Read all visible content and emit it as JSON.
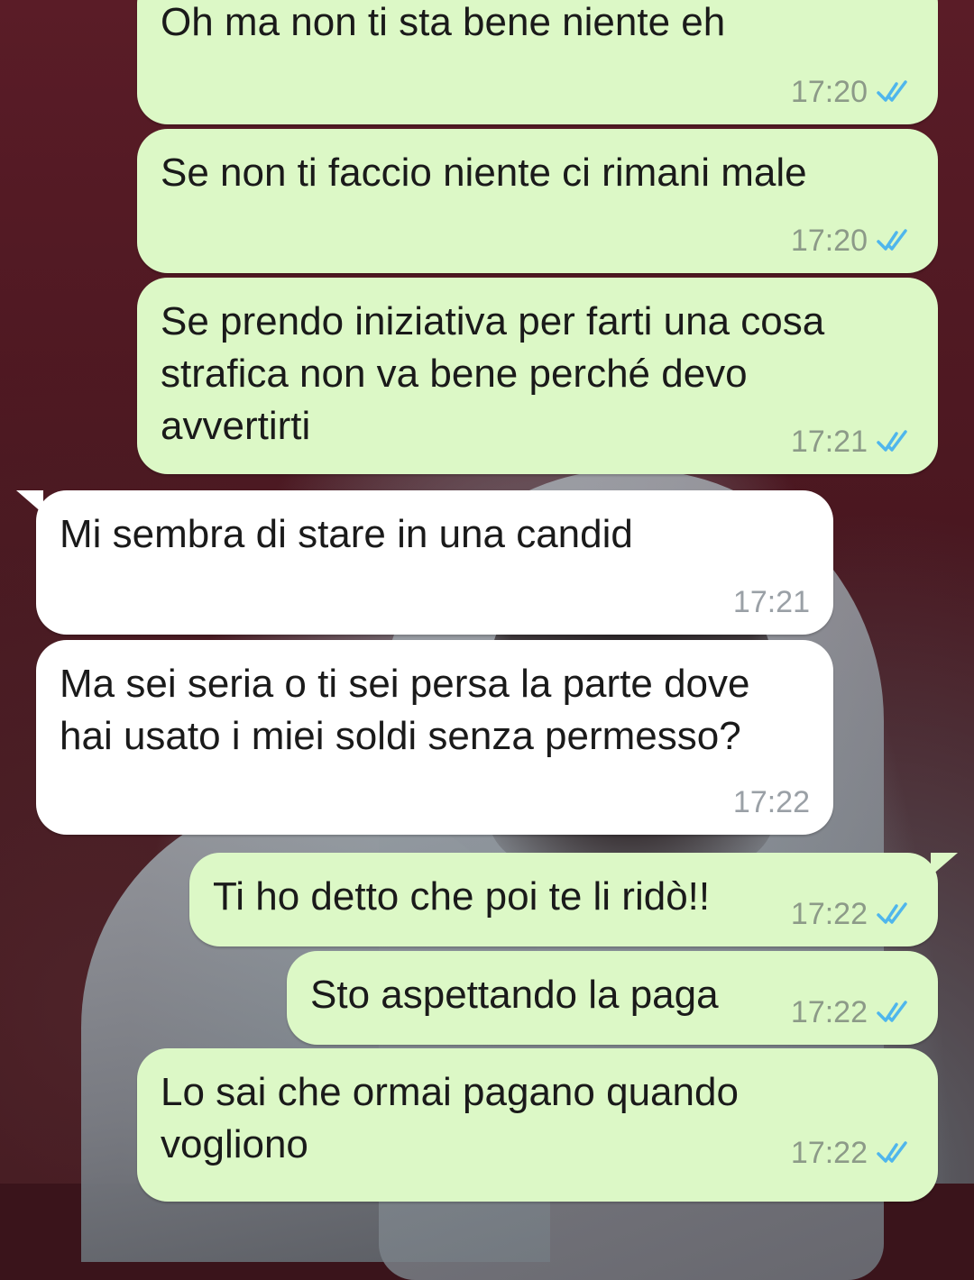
{
  "chat": {
    "messages": [
      {
        "direction": "outgoing",
        "text": "Oh ma non ti sta bene niente eh",
        "time": "17:20",
        "status_icon": "double-check-read-icon"
      },
      {
        "direction": "outgoing",
        "text": "Se non ti faccio niente ci rimani male",
        "time": "17:20",
        "status_icon": "double-check-read-icon"
      },
      {
        "direction": "outgoing",
        "text": "Se prendo iniziativa per farti una cosa\nstrafica non va bene perché devo\navvertirti",
        "time": "17:21",
        "status_icon": "double-check-read-icon"
      },
      {
        "direction": "incoming",
        "text": "Mi sembra di stare in una candid",
        "time": "17:21"
      },
      {
        "direction": "incoming",
        "text": "Ma sei seria o ti sei persa la parte dove\nhai usato i miei soldi senza permesso?",
        "time": "17:22"
      },
      {
        "direction": "outgoing",
        "text": "Ti ho detto che poi te li ridò!!",
        "time": "17:22",
        "status_icon": "double-check-read-icon"
      },
      {
        "direction": "outgoing",
        "text": "Sto aspettando la paga",
        "time": "17:22",
        "status_icon": "double-check-read-icon"
      },
      {
        "direction": "outgoing",
        "text": "Lo sai che ormai pagano quando\nvogliono",
        "time": "17:22",
        "status_icon": "double-check-read-icon"
      }
    ]
  },
  "colors": {
    "outgoing_bubble": "#dcf8c6",
    "incoming_bubble": "#ffffff",
    "read_ticks": "#4fb6ec",
    "wallpaper": "#4a1720"
  }
}
